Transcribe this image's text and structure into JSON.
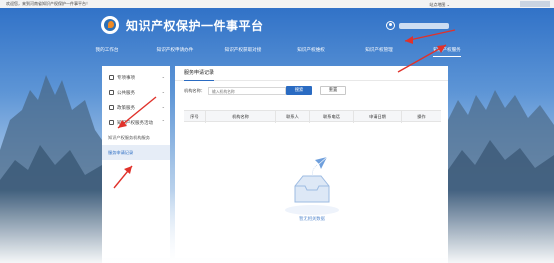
{
  "topbar": {
    "welcome": "欢迎您，来到河南省知识产权保护一件事平台！",
    "right_text": "站点地图 ⌄"
  },
  "header": {
    "title": "知识产权保护一件事平台"
  },
  "nav": {
    "items": [
      {
        "label": "我的工作台"
      },
      {
        "label": "知识产权申请办件"
      },
      {
        "label": "知识产权获取对接"
      },
      {
        "label": "知识产权维权"
      },
      {
        "label": "知识产权管理"
      },
      {
        "label": "知识产权服务",
        "active": true
      }
    ]
  },
  "sidebar": {
    "items": [
      {
        "label": "专项事项",
        "chevron": "⌄"
      },
      {
        "label": "公共服务",
        "chevron": "⌄"
      },
      {
        "label": "政策服务",
        "chevron": "⌄"
      },
      {
        "label": "知识产权服务活动",
        "chevron": "⌃"
      }
    ],
    "subitems": [
      {
        "label": "知识产权服务机构服务"
      },
      {
        "label": "服务申请记录",
        "active": true
      }
    ]
  },
  "main": {
    "title": "服务申请记录",
    "filter_label": "机构名称：",
    "filter_placeholder": "输入机构名称",
    "search_label": "搜索",
    "reset_label": "重置",
    "columns": [
      "序号",
      "机构名称",
      "联系人",
      "联系电话",
      "申请日期",
      "操作"
    ],
    "empty_text": "暂无相关数据"
  },
  "colors": {
    "accent": "#2a6bc2",
    "arrow": "#e0322b",
    "sky_top": "#2f73c9",
    "sky_bottom": "#eef4fb"
  },
  "icons": [
    "logo-icon",
    "user-icon",
    "chevron-down-icon",
    "chevron-up-icon",
    "empty-inbox-icon",
    "paper-plane-icon"
  ]
}
